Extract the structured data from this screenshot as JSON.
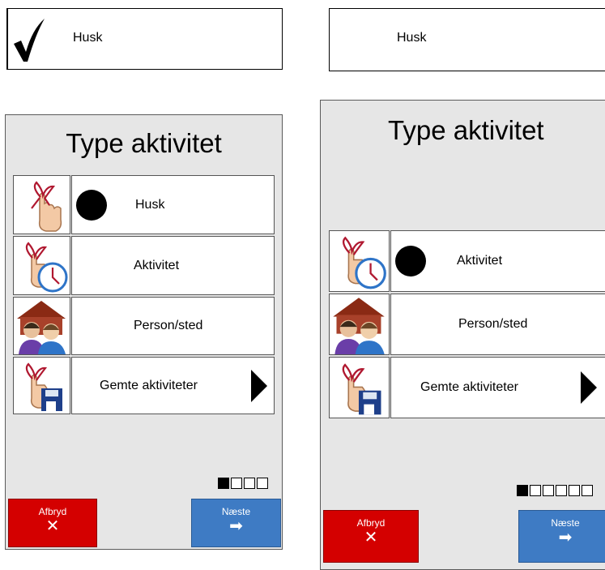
{
  "left": {
    "husk_box_label": "Husk",
    "title": "Type aktivitet",
    "options": [
      {
        "label": "Husk",
        "selected": true
      },
      {
        "label": "Aktivitet",
        "selected": false
      },
      {
        "label": "Person/sted",
        "selected": false
      },
      {
        "label": "Gemte aktiviteter",
        "selected": false
      }
    ],
    "pager": {
      "current": 1,
      "total": 4
    },
    "cancel_label": "Afbryd",
    "next_label": "Næste"
  },
  "right": {
    "husk_box_label": "Husk",
    "title": "Type aktivitet",
    "options": [
      {
        "label": "Aktivitet",
        "selected": true
      },
      {
        "label": "Person/sted",
        "selected": false
      },
      {
        "label": "Gemte aktiviteter",
        "selected": false
      }
    ],
    "pager": {
      "current": 1,
      "total": 6
    },
    "cancel_label": "Afbryd",
    "next_label": "Næste"
  },
  "colors": {
    "panel_bg": "#e6e6e6",
    "cancel_red": "#d40000",
    "next_blue": "#3e7bc4"
  },
  "icons": {
    "check": "checkmark-icon",
    "cancel": "x-icon",
    "next": "arrow-right-icon"
  }
}
